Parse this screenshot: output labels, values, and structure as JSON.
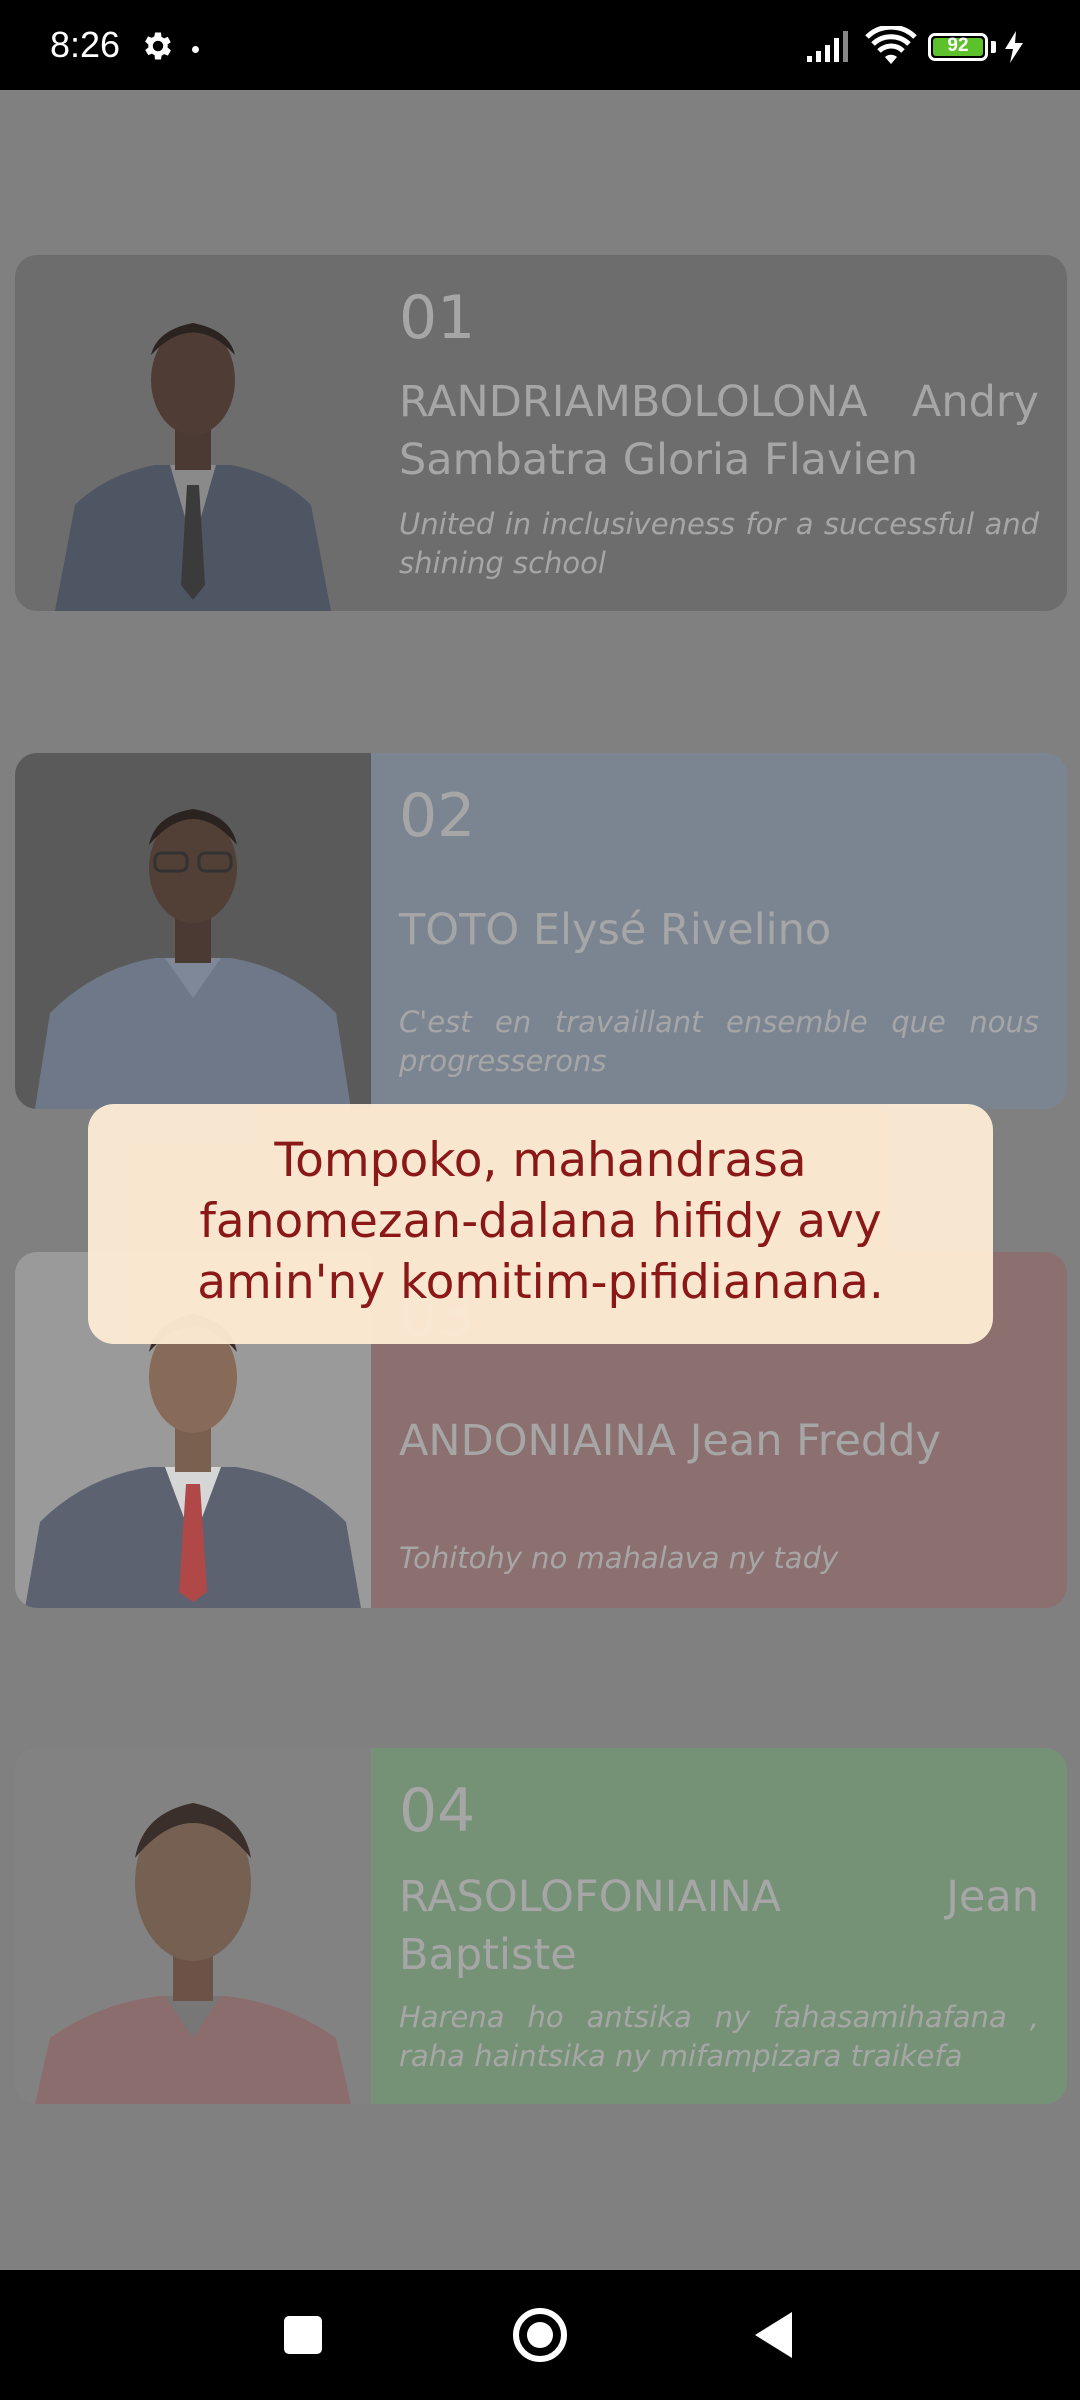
{
  "status_bar": {
    "time": "8:26",
    "battery_level": "92",
    "icons": [
      "gear-icon",
      "dot",
      "signal-icon",
      "wifi-icon",
      "battery-icon",
      "charging-bolt-icon"
    ]
  },
  "candidates": [
    {
      "number": "01",
      "name": "RANDRIAMBOLOLONA Andry Sambatra Gloria Flavien",
      "motto": "United in inclusiveness for a successful and shining school",
      "color": "#6d6d6d"
    },
    {
      "number": "02",
      "name": "TOTO Elysé Rivelino",
      "motto": "C'est en travaillant ensemble que nous progresserons",
      "color": "#7b8592"
    },
    {
      "number": "03",
      "name": "ANDONIAINA Jean Freddy",
      "motto": "Tohitohy no mahalava ny tady",
      "color": "#8c7070"
    },
    {
      "number": "04",
      "name": "RASOLOFONIAINA Jean Baptiste",
      "motto": "Harena ho antsika ny fahasamihafana , raha haintsika ny mifampizara traikefa",
      "color": "#769276"
    }
  ],
  "toast": {
    "message": "Tompoko, mahandrasa fanomezan-dalana hifidy avy amin'ny komitim-pifidianana."
  },
  "nav_bar": {
    "buttons": [
      "recents-button",
      "home-button",
      "back-button"
    ]
  }
}
